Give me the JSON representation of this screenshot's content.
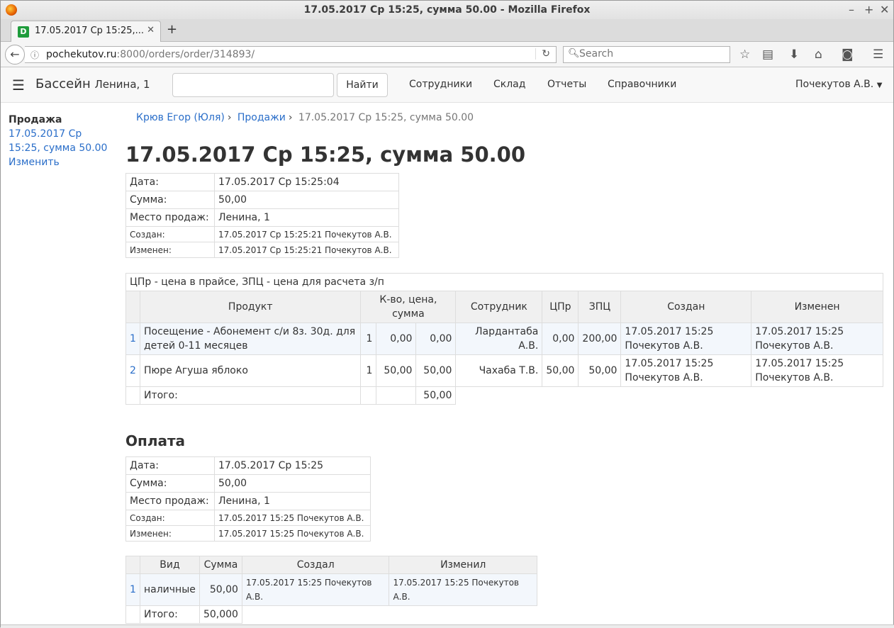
{
  "browser": {
    "window_title": "17.05.2017 Ср 15:25, сумма 50.00 - Mozilla Firefox",
    "tab_title": "17.05.2017 Ср 15:25,...",
    "tab_favicon_letter": "D",
    "url_host": "pochekutov.ru",
    "url_rest": ":8000/orders/order/314893/",
    "search_placeholder": "Search",
    "toolbar_icons": [
      "star-icon",
      "reading-list-icon",
      "download-icon",
      "home-icon",
      "pocket-icon",
      "menu-icon"
    ]
  },
  "app": {
    "brand": "Бассейн",
    "brand_sub": "Ленина, 1",
    "search_value": "",
    "find_button": "Найти",
    "menu": [
      "Сотрудники",
      "Склад",
      "Отчеты",
      "Справочники"
    ],
    "user": "Почекутов А.В."
  },
  "sidebar": {
    "title": "Продажа",
    "link_order_line1": "17.05.2017 Ср",
    "link_order_line2": "15:25, сумма 50.00",
    "link_edit": "Изменить"
  },
  "breadcrumb": {
    "client": "Крюв Егор (Юля)",
    "sales": "Продажи",
    "current": "17.05.2017 Ср 15:25, сумма 50.00"
  },
  "page_title": "17.05.2017 Ср 15:25, сумма 50.00",
  "order_info": {
    "date_label": "Дата:",
    "date_value": "17.05.2017 Ср 15:25:04",
    "sum_label": "Сумма:",
    "sum_value": "50,00",
    "place_label": "Место продаж:",
    "place_value": "Ленина, 1",
    "created_label": "Создан:",
    "created_value": "17.05.2017 Ср 15:25:21 Почекутов А.В.",
    "changed_label": "Изменен:",
    "changed_value": "17.05.2017 Ср 15:25:21 Почекутов А.В."
  },
  "items": {
    "caption": "ЦПр - цена в прайсе, ЗПЦ - цена для расчета з/п",
    "headers": {
      "product": "Продукт",
      "qty_price_sum": "К-во, цена, сумма",
      "employee": "Сотрудник",
      "cpr": "ЦПр",
      "zpc": "ЗПЦ",
      "created": "Создан",
      "changed": "Изменен"
    },
    "rows": [
      {
        "n": "1",
        "product": "Посещение - Абонемент с/и 8з. 30д. для детей 0-11 месяцев",
        "qty": "1",
        "price": "0,00",
        "sum": "0,00",
        "employee": "Лардантаба А.В.",
        "cpr": "0,00",
        "zpc": "200,00",
        "created": "17.05.2017 15:25 Почекутов А.В.",
        "changed": "17.05.2017 15:25 Почекутов А.В."
      },
      {
        "n": "2",
        "product": "Пюре Агуша яблоко",
        "qty": "1",
        "price": "50,00",
        "sum": "50,00",
        "employee": "Чахаба Т.В.",
        "cpr": "50,00",
        "zpc": "50,00",
        "created": "17.05.2017 15:25 Почекутов А.В.",
        "changed": "17.05.2017 15:25 Почекутов А.В."
      }
    ],
    "total_label": "Итого:",
    "total_value": "50,00"
  },
  "payment": {
    "title": "Оплата",
    "info": {
      "date_label": "Дата:",
      "date_value": "17.05.2017 Ср 15:25",
      "sum_label": "Сумма:",
      "sum_value": "50,00",
      "place_label": "Место продаж:",
      "place_value": "Ленина, 1",
      "created_label": "Создан:",
      "created_value": "17.05.2017 15:25 Почекутов А.В.",
      "changed_label": "Изменен:",
      "changed_value": "17.05.2017 15:25 Почекутов А.В."
    },
    "table": {
      "headers": {
        "kind": "Вид",
        "sum": "Сумма",
        "created": "Создал",
        "changed": "Изменил"
      },
      "rows": [
        {
          "n": "1",
          "kind": "наличные",
          "sum": "50,00",
          "created": "17.05.2017 15:25 Почекутов А.В.",
          "changed": "17.05.2017 15:25 Почекутов А.В."
        }
      ],
      "total_label": "Итого:",
      "total_value": "50,000"
    }
  }
}
